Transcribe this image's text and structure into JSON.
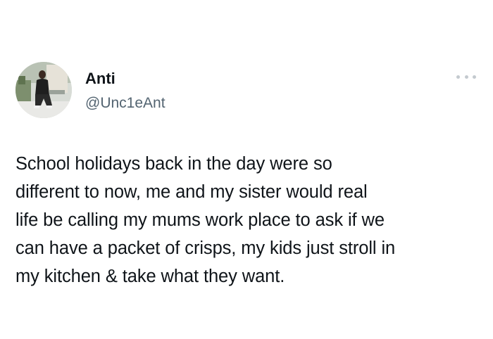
{
  "user": {
    "display_name": "Anti",
    "handle": "@Unc1eAnt",
    "avatar_icon": "profile-photo"
  },
  "actions": {
    "more_icon": "more-dots-icon"
  },
  "tweet": {
    "text": "School holidays back in the day were so\ndifferent to now, me and my sister would real\nlife be calling my mums work place to ask if we\ncan have a packet of crisps, my kids just stroll in\nmy kitchen & take what they want."
  },
  "colors": {
    "text": "#0f1419",
    "handle": "#536471",
    "dots": "#c4cacf",
    "background": "#ffffff"
  }
}
